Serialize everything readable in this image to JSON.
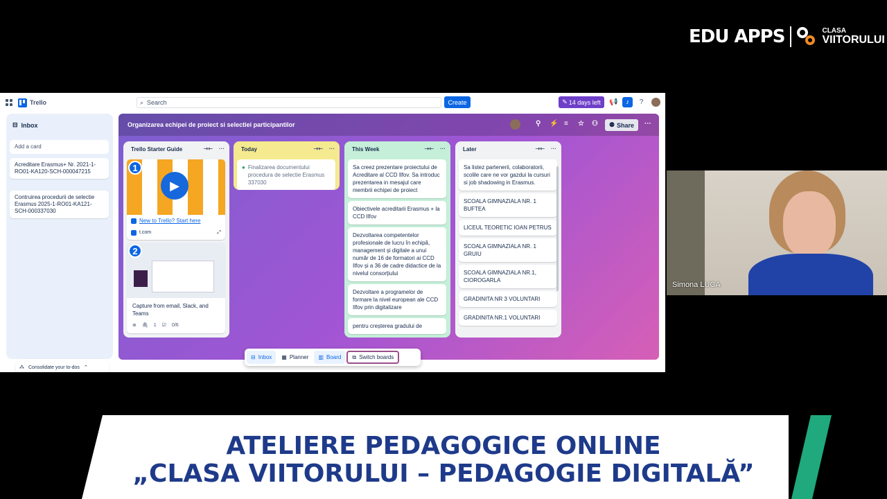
{
  "overlay": {
    "logo_brand": "EDU APPS",
    "logo_sub1": "CLASA",
    "logo_sub2": "VIITORULUI",
    "banner_line1": "ATELIERE PEDAGOGICE ONLINE",
    "banner_line2": "„CLASA VIITORULUI – PEDAGOGIE DIGITALĂ”"
  },
  "topbar": {
    "app_name": "Trello",
    "search_placeholder": "Search",
    "create_label": "Create",
    "trial_label": "14 days left"
  },
  "inbox": {
    "title": "Inbox",
    "add_card": "Add a card",
    "cards": [
      "Acreditare Erasmus+ Nr. 2021-1-RO01-KA120-SCH-000047215",
      "Contruirea procedurii de selectie Erasmus 2025-1-RO01-KA121-SCH-000337030"
    ],
    "consolidate_label": "Consolidate your to-dos"
  },
  "board": {
    "title": "Organizarea echipei de proiect si selectiei participantilor",
    "share_label": "Share",
    "lists": [
      {
        "title": "Trello Starter Guide",
        "cards": [
          {
            "badge": "1",
            "link": "New to Trello? Start here",
            "source": "t.com"
          },
          {
            "badge": "2",
            "text": "Capture from email, Slack, and Teams",
            "attachments": "1",
            "checklist": "0/6"
          }
        ]
      },
      {
        "title": "Today",
        "cards": [
          "Finalizarea documentului procedura de selectie Erasmus 337030"
        ]
      },
      {
        "title": "This Week",
        "cards": [
          "Sa creez prezentare proiectului de Acreditare al CCD Ilfov. Sa introduc prezentarea in mesajul care membrii echipei de proiect",
          "Obiectivele acreditarii Erasmus + la CCD Ilfov",
          "Dezvoltarea competentelor profesionale de lucru în echipă, management și digitale a unui număr de 16 de formatori ai CCD Ilfov și a 36 de cadre didactice de la nivelul consorțiului",
          "Dezvoltare a programelor de formare la nivel european ale CCD Ilfov prin digitalizare",
          "pentru creșterea gradului de"
        ]
      },
      {
        "title": "Later",
        "cards": [
          "Sa listez partenerii, colaboratorii, scolile care ne vor gazdui la cursuri si job shadowing in Erasmus.",
          "SCOALA GIMNAZIALA NR. 1 BUFTEA",
          "LICEUL TEORETIC IOAN PETRUS",
          "SCOALA GIMNAZIALA NR. 1 GRUIU",
          "SCOALA GIMNAZIALA NR.1, CIOROGARLA",
          "GRADINITA NR 3 VOLUNTARI",
          "GRADINITA NR.1 VOLUNTARI"
        ]
      }
    ]
  },
  "bottom_nav": {
    "inbox": "Inbox",
    "planner": "Planner",
    "board": "Board",
    "switch": "Switch boards"
  },
  "video": {
    "participant_name": "Simona LUCA"
  },
  "colors": {
    "brand_blue": "#0c66e4",
    "trial_purple": "#6e3fc8",
    "banner_text": "#1e3a8a",
    "stripe_green": "#1fa97c"
  }
}
